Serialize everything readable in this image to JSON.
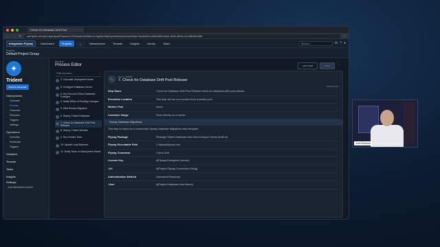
{
  "browser": {
    "tab_title": "Check for Database Drift Post",
    "url": "samples.octopus.app/app#/Spaces-103/projects/trident-regular/deployments/process/steps?actionId=c46cbd5d-bae3-4b4b-8b3c-1e1d8c6bb356"
  },
  "topnav": {
    "space": "Integration Flyway",
    "items": [
      "Dashboard",
      "Projects",
      "Infrastructure",
      "Tenants",
      "Insights",
      "Library",
      "Tasks"
    ],
    "search_placeholder": "Search..."
  },
  "project": {
    "label": "Projects",
    "group": "Default Project Group",
    "name": "Trident",
    "create_release": "CREATE RELEASE"
  },
  "sidebar": {
    "sections": [
      {
        "title": "Deployments",
        "items": [
          "Overview",
          "Process",
          "Channels",
          "Releases",
          "Triggers",
          "Settings"
        ]
      },
      {
        "title": "Operations",
        "items": [
          "Overview",
          "Runbooks",
          "Triggers"
        ]
      },
      {
        "title": "Variables",
        "items": []
      },
      {
        "title": "Tenants",
        "items": []
      },
      {
        "title": "Tasks",
        "items": []
      },
      {
        "title": "Insights",
        "items": []
      },
      {
        "title": "Settings",
        "items": []
      }
    ],
    "footer": "John Bristowe's screen"
  },
  "process": {
    "crumb": "Process",
    "title": "Process Editor",
    "add_step": "ADD STEP",
    "save": "SAVE",
    "filter_placeholder": "Filter by name...",
    "steps": [
      "3. Calculate Deployment Mode",
      "5. Configure Database Server",
      "6. Dry Run And Check Database Changes",
      "4. Notify DBAs of Pending Changes",
      "5. DBA Review Migration",
      "6. Deploy Trident Database",
      "7. Check for Database Drift Post Release",
      "8. Deploy Trident Website",
      "9. Run Smoke Tests",
      "10. Update Load Balancer",
      "11. Notify Team of Deployment Status"
    ]
  },
  "detail": {
    "kicker": "RUN A SCRIPT",
    "title": "7. Check for Database Drift Post Release",
    "expand": "EXPAND ALL",
    "rows": [
      {
        "k": "Step Name",
        "v": "Check for Database Drift Post Release  check-for-database-drift-post-release"
      },
      {
        "k": "Execution Location",
        "v": "This step will run on a worker from a worker pool"
      },
      {
        "k": "Worker Pool",
        "v": "Azure"
      },
      {
        "k": "Container Image",
        "v": "Runs directly on a worker"
      }
    ],
    "band": "Flyway Database Migrations",
    "note": "This step is based on a community Flyway Database Migrations step template.",
    "rows2": [
      {
        "k": "Flyway Package",
        "v": "Package Trident.Database from feed Octopus Server (built-in)"
      },
      {
        "k": "Flyway Executable Path",
        "v": "C:\\flyway\\flyway.cmd"
      },
      {
        "k": "Flyway Command",
        "v": "Check Drift"
      },
      {
        "k": "License Key",
        "v": "#{Flyway.Enterprise.License}"
      },
      {
        "k": "-Url",
        "v": "#{Project.Flyway.Connection.String}"
      },
      {
        "k": "Authentication Method",
        "v": "Username\\Password"
      },
      {
        "k": "-User",
        "v": "#{Project.Database.User.Name}"
      }
    ]
  },
  "webcam": {
    "name": "John Bristowe"
  }
}
